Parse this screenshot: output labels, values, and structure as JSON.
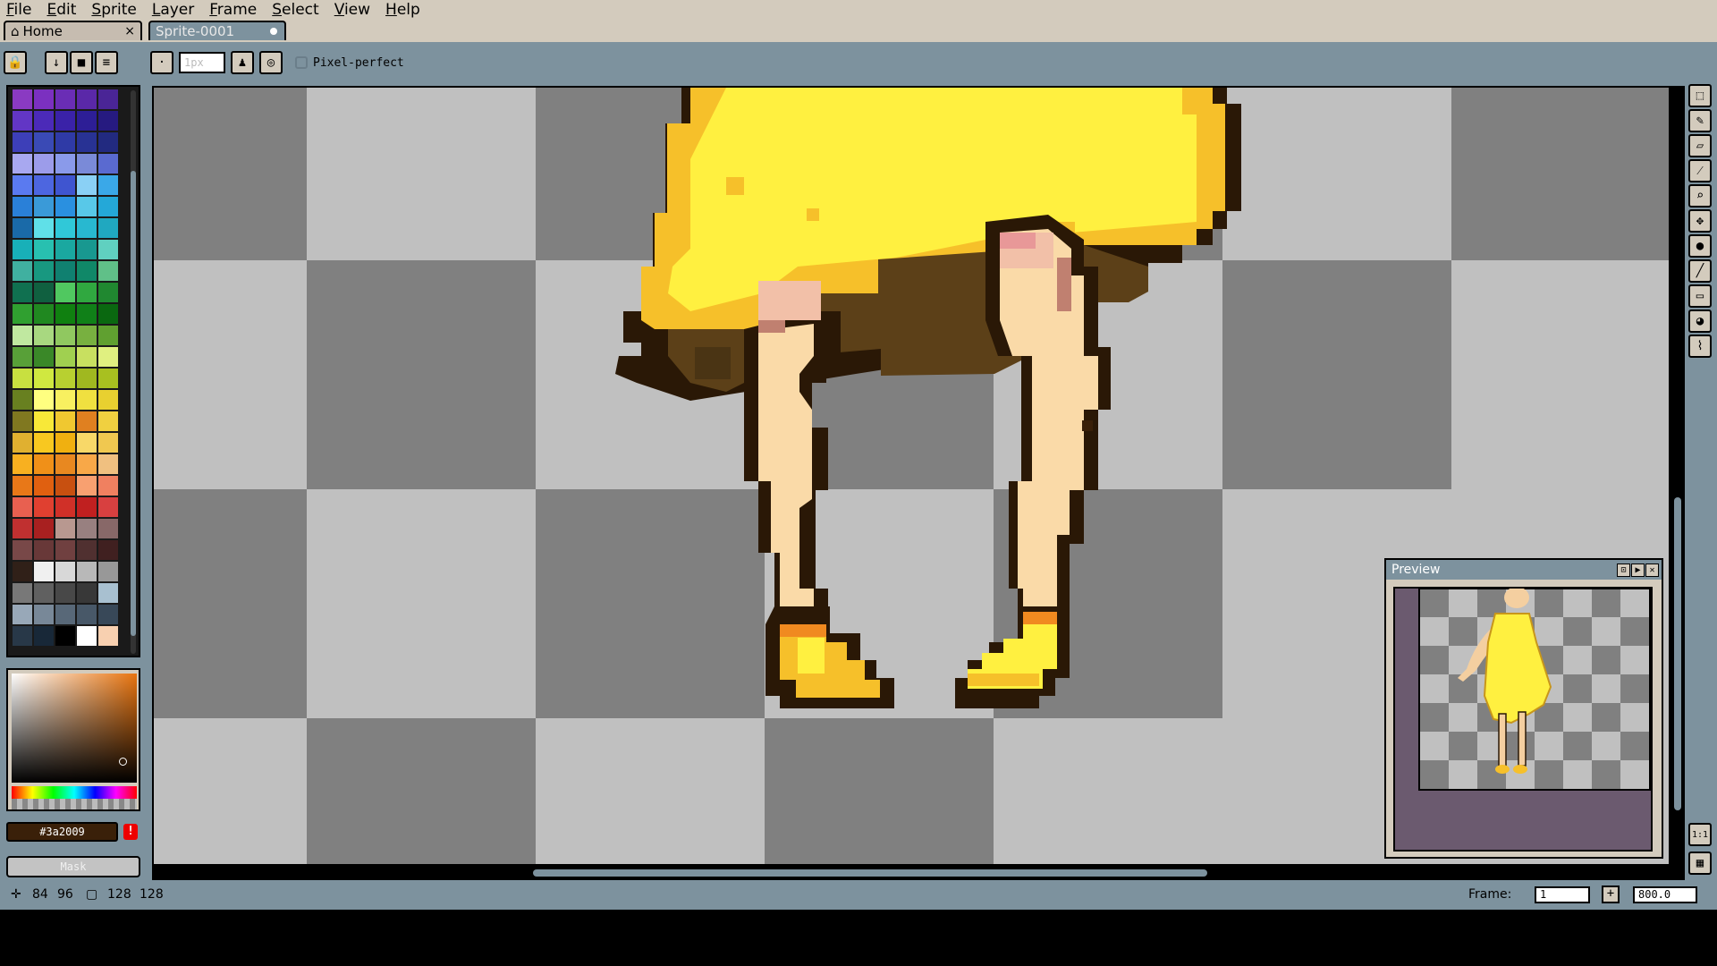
{
  "menu": [
    "File",
    "Edit",
    "Sprite",
    "Layer",
    "Frame",
    "Select",
    "View",
    "Help"
  ],
  "tabs": {
    "home": "Home",
    "home_close": "×",
    "sprite": "Sprite-0001"
  },
  "toolbar": {
    "brush_size": "1px",
    "pixel_perfect_label": "Pixel-perfect"
  },
  "palette_colors": [
    "#8a3ac2",
    "#7b30c0",
    "#6a2db5",
    "#5a28a8",
    "#4a2596",
    "#6236c5",
    "#4b2ab8",
    "#3a22a8",
    "#2d1e96",
    "#261a80",
    "#3d3fb8",
    "#3a4ab5",
    "#2f3aa6",
    "#283294",
    "#222a80",
    "#a8a8f0",
    "#9c9cea",
    "#8a9aea",
    "#7a8ad8",
    "#5a6ad0",
    "#5a7af0",
    "#4d66e0",
    "#3f55d0",
    "#8ad0f5",
    "#3aa8e8",
    "#2a80d8",
    "#3a9ad8",
    "#2a90e0",
    "#58c8e8",
    "#24a8d8",
    "#1a6aa8",
    "#60e0e8",
    "#30c8d8",
    "#28b8d0",
    "#20a8c0",
    "#18b0b8",
    "#28c0b0",
    "#1aa8a0",
    "#189890",
    "#60d0c0",
    "#40b0a0",
    "#189880",
    "#108070",
    "#108868",
    "#60c088",
    "#107050",
    "#106040",
    "#50c860",
    "#30a840",
    "#208830",
    "#30a030",
    "#208820",
    "#108010",
    "#108018",
    "#0a6810",
    "#c0e8a0",
    "#a8d880",
    "#90c860",
    "#78b040",
    "#60a030",
    "#58a038",
    "#3a8828",
    "#a0d050",
    "#c8e060",
    "#e0f080",
    "#c8e040",
    "#d0e840",
    "#b8d030",
    "#a0b820",
    "#a8c020",
    "#688020",
    "#ffff80",
    "#f8f060",
    "#f0e040",
    "#e8d030",
    "#807820",
    "#f8e838",
    "#f0c830",
    "#e08020",
    "#f0d040",
    "#e0b030",
    "#f8c820",
    "#f0b010",
    "#f8d868",
    "#f0c850",
    "#f8b020",
    "#f09018",
    "#e88820",
    "#f8a848",
    "#f0c080",
    "#e87818",
    "#e06010",
    "#c85010",
    "#f8a070",
    "#f08060",
    "#e86050",
    "#e04030",
    "#d03028",
    "#c02020",
    "#d84040",
    "#c03030",
    "#a82020",
    "#b89890",
    "#988080",
    "#886868",
    "#784848",
    "#683838",
    "#704040",
    "#503030",
    "#402020",
    "#302018",
    "#f0f0f0",
    "#d8d8d8",
    "#b8b8b8",
    "#989898",
    "#787878",
    "#606060",
    "#484848",
    "#383838",
    "#a8c0d0",
    "#98a8b8",
    "#788898",
    "#586878",
    "#485868",
    "#384858",
    "#283848",
    "#182838",
    "#000000",
    "#ffffff",
    "#f8d0b0"
  ],
  "color": {
    "hex": "#3a2009",
    "warning": "!"
  },
  "mask_label": "Mask",
  "preview": {
    "title": "Preview"
  },
  "status": {
    "cursor_x": "84",
    "cursor_y": "96",
    "sprite_w": "128",
    "sprite_h": "128",
    "frame_label": "Frame:",
    "frame_value": "1",
    "plus": "+",
    "zoom": "800.0"
  },
  "right_tools": [
    "marquee-icon",
    "pencil-icon",
    "eraser-icon",
    "eyedropper-icon",
    "zoom-icon",
    "move-icon",
    "paint-bucket-icon",
    "line-icon",
    "rectangle-icon",
    "contour-icon",
    "blur-icon"
  ],
  "right_bottom": {
    "one_to_one": "1:1"
  }
}
